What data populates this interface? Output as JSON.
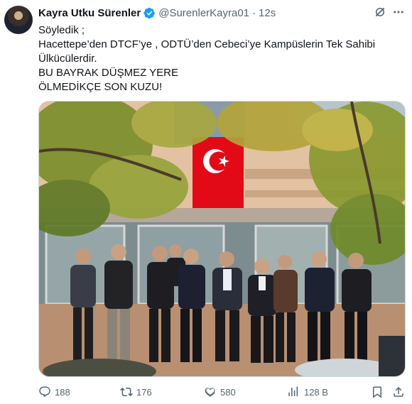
{
  "tweet": {
    "author_name": "Kayra Utku Sürenler",
    "handle": "@SurenlerKayra01",
    "separator": "·",
    "time": "12s",
    "lines": [
      "Söyledik ;",
      "Hacettepe’den DTCF’ye , ODTÜ’den Cebeci’ye Kampüslerin Tek Sahibi",
      "Ülkücülerdir.",
      "BU BAYRAK DÜŞMEZ YERE",
      "ÖLMEDİKÇE SON KUZU!"
    ]
  },
  "actions": {
    "replies": "188",
    "reposts": "176",
    "likes": "580",
    "views": "128 B"
  },
  "colors": {
    "text_primary": "#0f1419",
    "text_secondary": "#536471",
    "verified_blue": "#1d9bf0",
    "flag_red": "#e30a17"
  },
  "icons": [
    "verified-badge-icon",
    "grok-icon",
    "more-icon",
    "reply-icon",
    "repost-icon",
    "like-icon",
    "views-icon",
    "bookmark-icon",
    "share-icon"
  ]
}
